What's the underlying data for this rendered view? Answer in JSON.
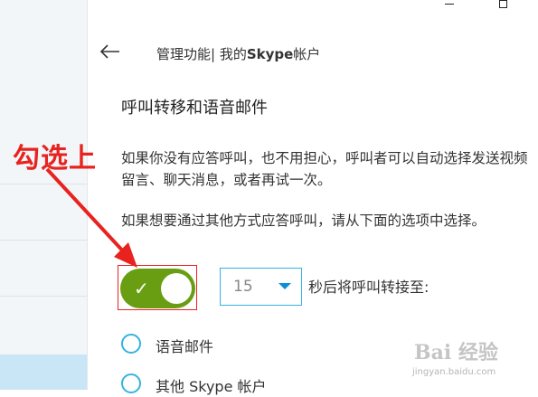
{
  "header": {
    "breadcrumb_prefix": "管理功能| 我的",
    "breadcrumb_brand": "Skype",
    "breadcrumb_suffix": "帐户"
  },
  "section": {
    "title": "呼叫转移和语音邮件",
    "para1": "如果你没有应答呼叫，也不用担心，呼叫者可以自动选择发送视频留言、聊天消息，或者再试一次。",
    "para2": "如果想要通过其他方式应答呼叫，请从下面的选项中选择。"
  },
  "forwarding": {
    "toggle_on": true,
    "delay_value": "15",
    "after_label": "秒后将呼叫转接至:"
  },
  "options": [
    {
      "label": "语音邮件"
    },
    {
      "label": "其他 Skype 帐户"
    }
  ],
  "annotation": {
    "label": "勾选上",
    "color": "#e8231f"
  },
  "watermark": {
    "logo": "Bai 经验",
    "url": "jingyan.baidu.com"
  },
  "colors": {
    "toggle_on": "#6a9e12",
    "accent": "#35b3e0",
    "caret": "#0a8fd6"
  }
}
